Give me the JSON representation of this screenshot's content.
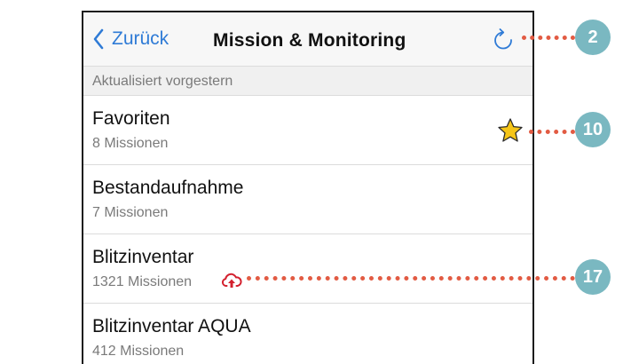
{
  "nav": {
    "back_label": "Zurück",
    "title": "Mission & Monitoring",
    "refresh_icon": "refresh-icon"
  },
  "subheader": {
    "text": "Aktualisiert vorgestern"
  },
  "list": [
    {
      "name": "Favoriten",
      "count": "8 Missionen",
      "icon": "star-icon"
    },
    {
      "name": "Bestandaufnahme",
      "count": "7 Missionen"
    },
    {
      "name": "Blitzinventar",
      "count": "1321 Missionen",
      "icon": "cloud-upload-icon"
    },
    {
      "name": "Blitzinventar AQUA",
      "count": "412 Missionen"
    }
  ],
  "callouts": [
    "2",
    "10",
    "17"
  ],
  "colors": {
    "accent": "#2f7bd6",
    "star": "#f5c518",
    "cloud": "#d3202e",
    "callout_line": "#e25b43",
    "callout_badge": "#7ab8c1"
  }
}
